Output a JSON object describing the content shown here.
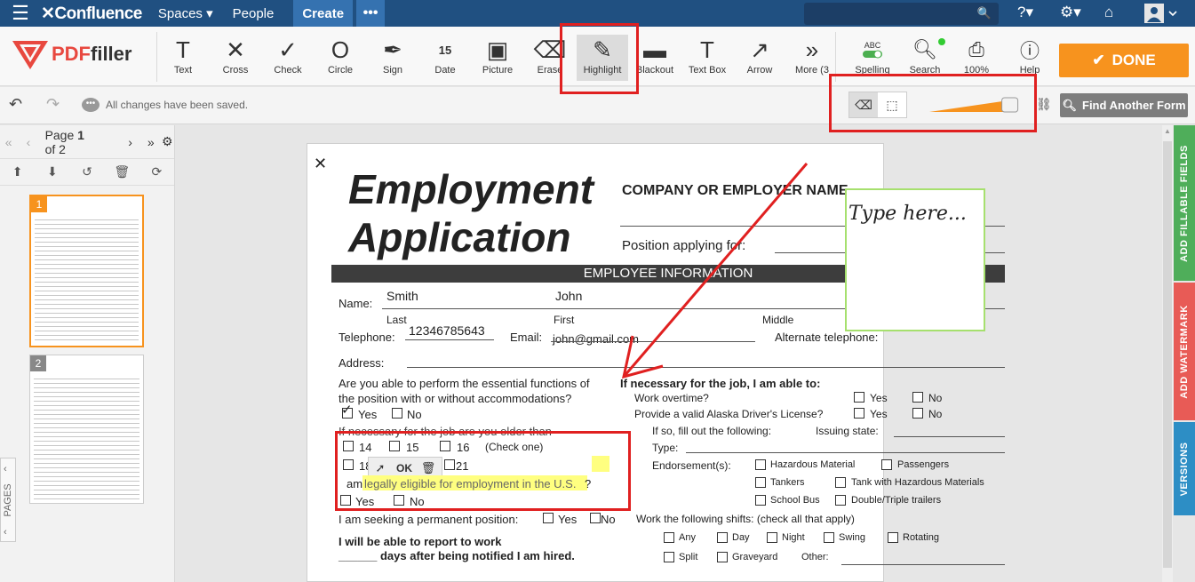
{
  "confluence": {
    "logo": "Confluence",
    "nav": [
      "Spaces",
      "People"
    ],
    "create_label": "Create",
    "more_label": "•••"
  },
  "toolbar": {
    "brand_pdf": "PDF",
    "brand_filler": "filler",
    "tools": [
      {
        "glyph": "T",
        "label": "Text",
        "icon": "text-icon"
      },
      {
        "glyph": "✕",
        "label": "Cross",
        "icon": "cross-icon"
      },
      {
        "glyph": "✓",
        "label": "Check",
        "icon": "check-icon"
      },
      {
        "glyph": "O",
        "label": "Circle",
        "icon": "circle-icon"
      },
      {
        "glyph": "✒",
        "label": "Sign",
        "icon": "sign-icon"
      },
      {
        "glyph": "15",
        "label": "Date",
        "icon": "date-icon"
      },
      {
        "glyph": "▣",
        "label": "Picture",
        "icon": "picture-icon"
      },
      {
        "glyph": "⌫",
        "label": "Erase",
        "icon": "erase-icon"
      },
      {
        "glyph": "✎",
        "label": "Highlight",
        "icon": "highlight-icon"
      },
      {
        "glyph": "▬",
        "label": "Blackout",
        "icon": "blackout-icon"
      },
      {
        "glyph": "T",
        "label": "Text Box",
        "icon": "textbox-icon"
      },
      {
        "glyph": "↗",
        "label": "Arrow",
        "icon": "arrow-icon"
      },
      {
        "glyph": "»",
        "label": "More (3",
        "icon": "more-icon"
      }
    ],
    "spelling": {
      "badge": "ABC",
      "label": "Spelling"
    },
    "search_label": "Search",
    "zoom_label": "100%",
    "help_label": "Help",
    "done_label": "DONE"
  },
  "secondary": {
    "saved_text": "All changes have been saved.",
    "find_label": "Find Another Form",
    "slider_level": 0.85
  },
  "pages": {
    "page_prefix": "Page",
    "current": "1",
    "of_text": "of 2",
    "thumbs": [
      "1",
      "2"
    ],
    "tab_label": "PAGES"
  },
  "document": {
    "title_line1": "Employment",
    "title_line2": "Application",
    "company_label": "COMPANY OR EMPLOYER NAME",
    "position_label": "Position applying for:",
    "section_header": "EMPLOYEE INFORMATION",
    "name_label": "Name:",
    "last_name_value": "Smith",
    "first_name_value": "John",
    "last_label": "Last",
    "first_label": "First",
    "middle_label": "Middle",
    "telephone_label": "Telephone:",
    "telephone_value": "12346785643",
    "email_label": "Email:",
    "email_value": "john@gmail.com",
    "alt_phone_label": "Alternate telephone:",
    "address_label": "Address:",
    "q_perform_1": "Are you able to perform the essential functions of",
    "q_perform_2": "the position with or without accommodations?",
    "yes": "Yes",
    "no": "No",
    "q_older": "If necessary for the job are you older than",
    "age_14": "14",
    "age_15": "15",
    "age_16": "16",
    "check_one": "(Check one)",
    "age_18": "18",
    "age_21": "21",
    "ok_label": "OK",
    "eligible_prefix": "am",
    "eligible_text": "legally eligible for employment in the U.S.",
    "eligible_q": "?",
    "permanent_label": "I am seeking a permanent position:",
    "report_line1": "I will be able to report to work",
    "report_line2": "______ days after being notified I am hired.",
    "if_necessary": "If necessary for the job, I am able to:",
    "work_overtime": "Work overtime?",
    "drivers_license": "Provide a valid Alaska Driver's License?",
    "fill_out": "If so, fill out the following:",
    "issuing_state": "Issuing state:",
    "type_label": "Type:",
    "endorsements": "Endorsement(s):",
    "hazardous": "Hazardous Material",
    "passengers": "Passengers",
    "tankers": "Tankers",
    "tank_haz": "Tank with Hazardous Materials",
    "school_bus": "School Bus",
    "double_triple": "Double/Triple trailers",
    "shifts_label": "Work the following shifts: (check all that apply)",
    "any": "Any",
    "day": "Day",
    "night": "Night",
    "swing": "Swing",
    "rotating": "Rotating",
    "split": "Split",
    "graveyard": "Graveyard",
    "other": "Other:",
    "type_here": "Type here..."
  },
  "right_tabs": [
    {
      "label": "ADD FILLABLE FIELDS",
      "color": "#4fae5a"
    },
    {
      "label": "ADD WATERMARK",
      "color": "#e85b56"
    },
    {
      "label": "VERSIONS",
      "color": "#2d8ec5"
    }
  ],
  "colors": {
    "confluence_blue": "#205081",
    "done_orange": "#f7931e",
    "annotation_red": "#e02020",
    "highlight_yellow": "#ffff80"
  }
}
